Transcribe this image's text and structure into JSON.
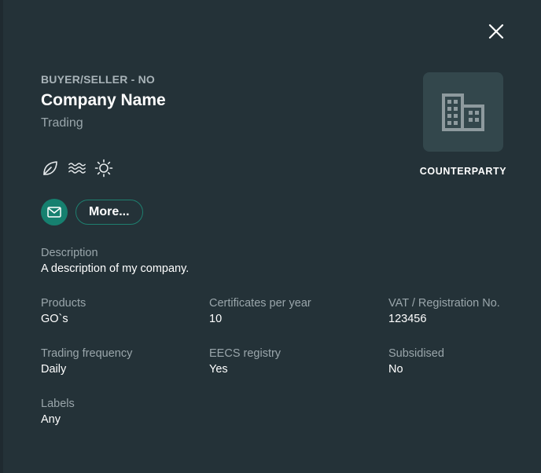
{
  "header": {
    "role": "BUYER/SELLER - NO",
    "company_name": "Company Name",
    "subtitle": "Trading"
  },
  "energy_icons": [
    "leaf-icon",
    "water-waves-icon",
    "sun-icon"
  ],
  "actions": {
    "mail_icon": "mail-icon",
    "more_label": "More..."
  },
  "logo": {
    "icon": "building-icon",
    "caption": "COUNTERPARTY"
  },
  "details": {
    "description": {
      "label": "Description",
      "value": "A description of my company."
    },
    "products": {
      "label": "Products",
      "value": "GO`s"
    },
    "certificates": {
      "label": "Certificates per year",
      "value": "10"
    },
    "vat": {
      "label": "VAT / Registration No.",
      "value": "123456"
    },
    "trading_frequency": {
      "label": "Trading frequency",
      "value": "Daily"
    },
    "eecs_registry": {
      "label": "EECS registry",
      "value": "Yes"
    },
    "subsidised": {
      "label": "Subsidised",
      "value": "No"
    },
    "labels": {
      "label": "Labels",
      "value": "Any"
    }
  },
  "colors": {
    "background": "#243238",
    "accent": "#16806f",
    "logo_box": "#33474c",
    "muted_text": "#9aa6ab"
  }
}
